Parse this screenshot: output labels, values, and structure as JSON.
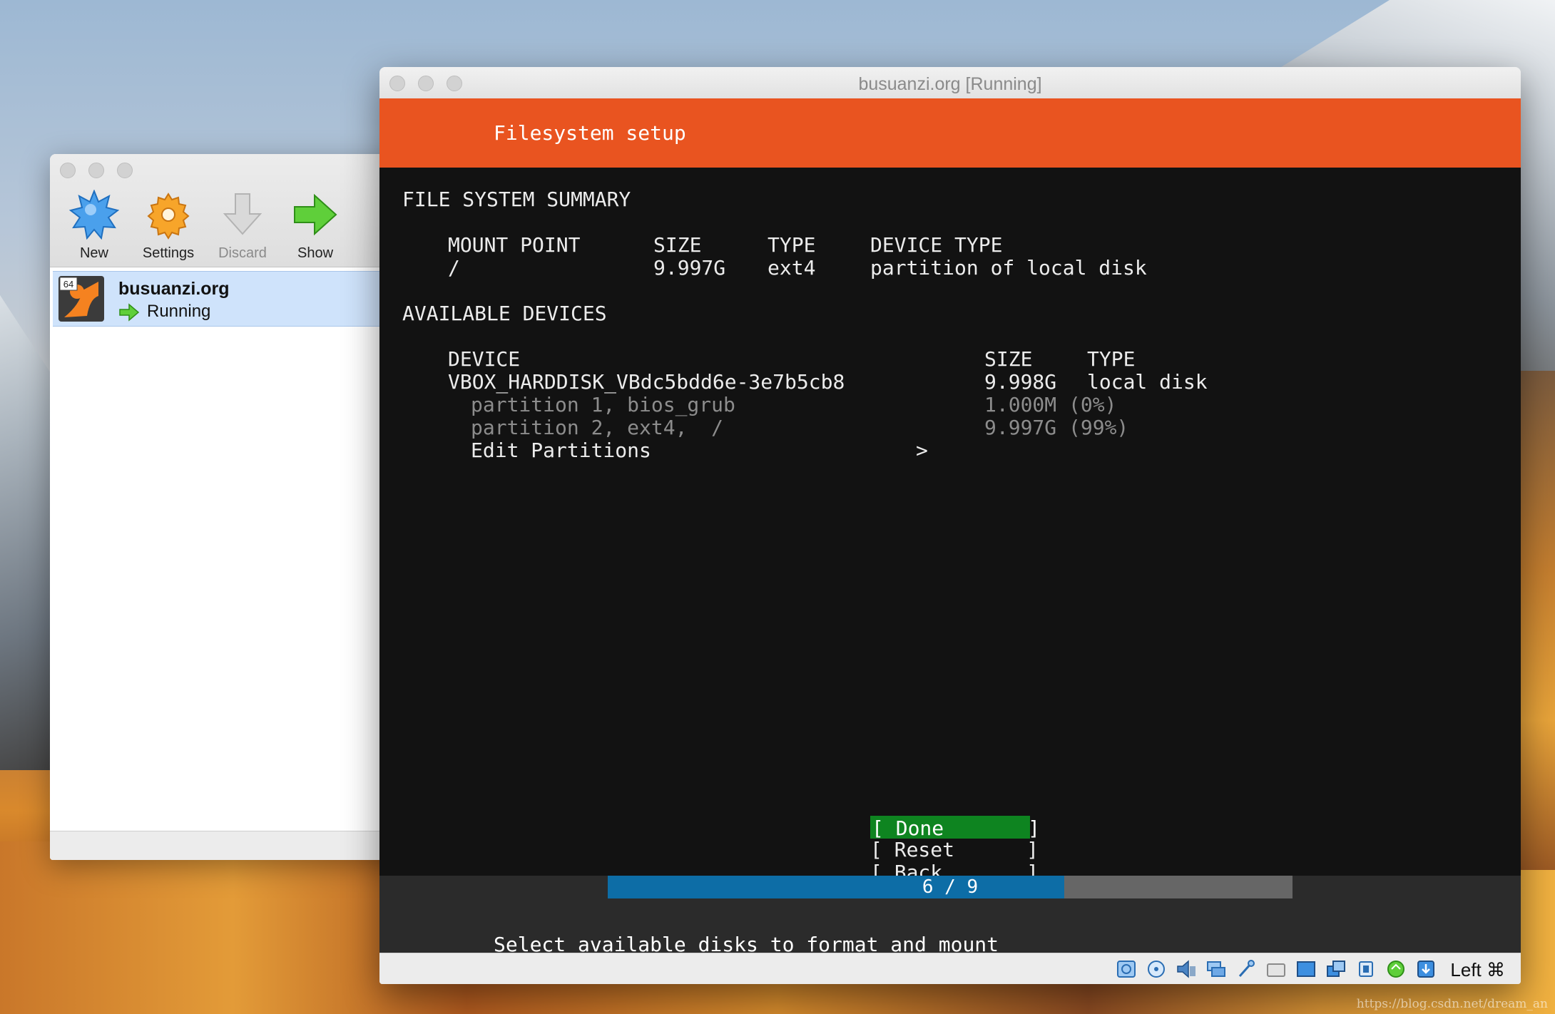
{
  "manager": {
    "toolbar": {
      "new_label": "New",
      "settings_label": "Settings",
      "discard_label": "Discard",
      "show_label": "Show"
    },
    "vm": {
      "os_badge": "64",
      "name": "busuanzi.org",
      "state": "Running"
    }
  },
  "vm_window": {
    "title": "busuanzi.org [Running]"
  },
  "installer": {
    "header": "Filesystem setup",
    "summary_title": "FILE SYSTEM SUMMARY",
    "summary_columns": [
      "MOUNT POINT",
      "SIZE",
      "TYPE",
      "DEVICE TYPE"
    ],
    "summary_rows": [
      {
        "mount": "/",
        "size": "9.997G",
        "type": "ext4",
        "device_type": "partition of local disk"
      }
    ],
    "available_title": "AVAILABLE DEVICES",
    "device_columns": [
      "DEVICE",
      "SIZE",
      "TYPE"
    ],
    "disk": {
      "name": "VBOX_HARDDISK_VBdc5bdd6e-3e7b5cb8",
      "size": "9.998G",
      "type": "local disk"
    },
    "partitions": [
      {
        "name": "partition 1, bios_grub",
        "size": "1.000M (0%)"
      },
      {
        "name": "partition 2, ext4,  /",
        "size": "9.997G (99%)"
      }
    ],
    "edit_partitions": "Edit Partitions",
    "edit_arrow": ">",
    "buttons": {
      "done": "[ Done       ]",
      "reset": "[ Reset      ]",
      "back": "[ Back       ]"
    },
    "progress": {
      "text": "6 / 9",
      "current": 6,
      "total": 9
    },
    "help": "Select available disks to format and mount"
  },
  "statusbar": {
    "icons": [
      "hard-disk-icon",
      "optical-disk-icon",
      "audio-icon",
      "network-icon",
      "usb-icon",
      "shared-folders-icon",
      "display-icon",
      "video-capture-icon",
      "cpu-icon",
      "mouse-integration-icon",
      "keyboard-capture-icon"
    ],
    "host_key": "Left ⌘"
  },
  "watermark": "https://blog.csdn.net/dream_an"
}
